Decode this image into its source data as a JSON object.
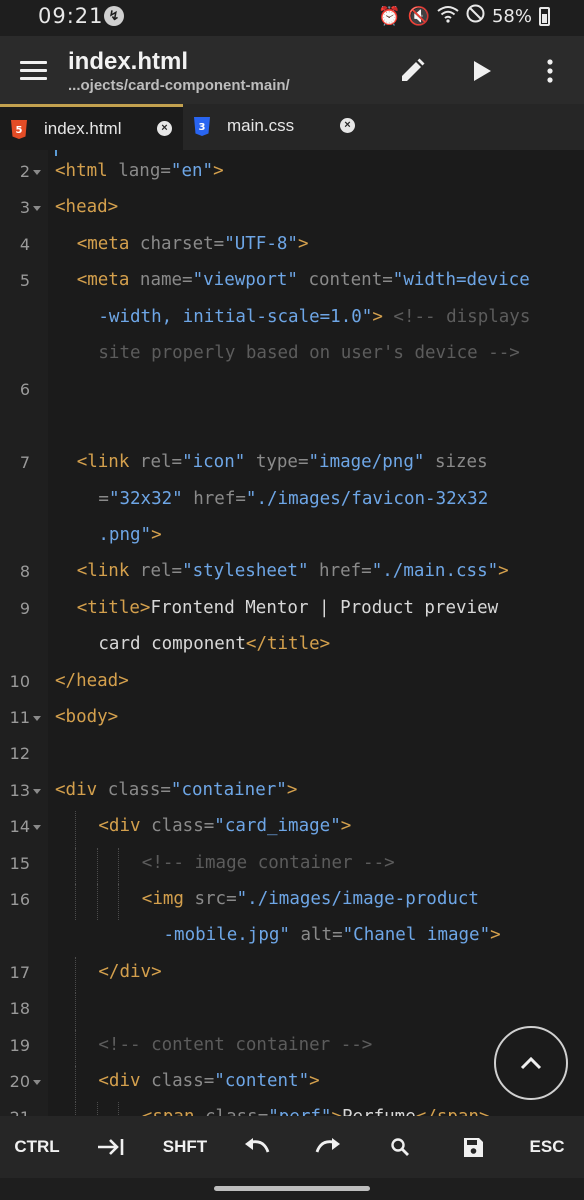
{
  "status_bar": {
    "time": "09:21",
    "battery": "58%"
  },
  "app_bar": {
    "title": "index.html",
    "subtitle": "...ojects/card-component-main/"
  },
  "tabs": [
    {
      "label": "index.html",
      "icon": "html5-icon",
      "active": true
    },
    {
      "label": "main.css",
      "icon": "css3-icon",
      "active": false
    }
  ],
  "lines": [
    {
      "num": "2",
      "fold": true,
      "indent": 0,
      "tokens": [
        [
          "tag",
          "<html "
        ],
        [
          "attr",
          "lang="
        ],
        [
          "str",
          "\"en\""
        ],
        [
          "tag",
          ">"
        ]
      ]
    },
    {
      "num": "3",
      "fold": true,
      "indent": 0,
      "tokens": [
        [
          "tag",
          "<head>"
        ]
      ]
    },
    {
      "num": "4",
      "fold": false,
      "indent": 1,
      "tokens": [
        [
          "tag",
          "<meta "
        ],
        [
          "attr",
          "charset="
        ],
        [
          "str",
          "\"UTF-8\""
        ],
        [
          "tag",
          ">"
        ]
      ]
    },
    {
      "num": "5",
      "fold": false,
      "indent": 1,
      "tokens": [
        [
          "tag",
          "<meta "
        ],
        [
          "attr",
          "name="
        ],
        [
          "str",
          "\"viewport\""
        ],
        [
          "attr",
          " content="
        ],
        [
          "str",
          "\"width=device"
        ]
      ]
    },
    {
      "num": "",
      "fold": false,
      "indent": 2,
      "tokens": [
        [
          "str",
          "-width, initial-scale=1.0\""
        ],
        [
          "tag",
          ">"
        ],
        [
          "cmt",
          " <!-- displays"
        ]
      ]
    },
    {
      "num": "",
      "fold": false,
      "indent": 2,
      "tokens": [
        [
          "cmt",
          "site properly based on user's device -->"
        ]
      ]
    },
    {
      "num": "6",
      "fold": false,
      "indent": 0,
      "tokens": []
    },
    {
      "num": "",
      "fold": false,
      "indent": 0,
      "tokens": []
    },
    {
      "num": "7",
      "fold": false,
      "indent": 1,
      "tokens": [
        [
          "tag",
          "<link "
        ],
        [
          "attr",
          "rel="
        ],
        [
          "str",
          "\"icon\""
        ],
        [
          "attr",
          " type="
        ],
        [
          "str",
          "\"image/png\""
        ],
        [
          "attr",
          " sizes"
        ]
      ]
    },
    {
      "num": "",
      "fold": false,
      "indent": 2,
      "tokens": [
        [
          "attr",
          "="
        ],
        [
          "str",
          "\"32x32\""
        ],
        [
          "attr",
          " href="
        ],
        [
          "str",
          "\"./images/favicon-32x32"
        ]
      ]
    },
    {
      "num": "",
      "fold": false,
      "indent": 2,
      "tokens": [
        [
          "str",
          ".png\""
        ],
        [
          "tag",
          ">"
        ]
      ]
    },
    {
      "num": "8",
      "fold": false,
      "indent": 1,
      "tokens": [
        [
          "tag",
          "<link "
        ],
        [
          "attr",
          "rel="
        ],
        [
          "str",
          "\"stylesheet\""
        ],
        [
          "attr",
          " href="
        ],
        [
          "str",
          "\"./main.css\""
        ],
        [
          "tag",
          ">"
        ]
      ]
    },
    {
      "num": "9",
      "fold": false,
      "indent": 1,
      "tokens": [
        [
          "tag",
          "<title>"
        ],
        [
          "txt",
          "Frontend Mentor | Product preview"
        ]
      ]
    },
    {
      "num": "",
      "fold": false,
      "indent": 2,
      "tokens": [
        [
          "txt",
          "card component"
        ],
        [
          "tag",
          "</title>"
        ]
      ]
    },
    {
      "num": "10",
      "fold": false,
      "indent": 0,
      "tokens": [
        [
          "tag",
          "</head>"
        ]
      ]
    },
    {
      "num": "11",
      "fold": true,
      "indent": 0,
      "tokens": [
        [
          "tag",
          "<body>"
        ]
      ]
    },
    {
      "num": "12",
      "fold": false,
      "indent": 0,
      "tokens": []
    },
    {
      "num": "13",
      "fold": true,
      "indent": 0,
      "tokens": [
        [
          "tag",
          "<div "
        ],
        [
          "attr",
          "class="
        ],
        [
          "str",
          "\"container\""
        ],
        [
          "tag",
          ">"
        ]
      ]
    },
    {
      "num": "14",
      "fold": true,
      "indent": 2,
      "guides": 1,
      "tokens": [
        [
          "tag",
          "<div "
        ],
        [
          "attr",
          "class="
        ],
        [
          "str",
          "\"card_image\""
        ],
        [
          "tag",
          ">"
        ]
      ]
    },
    {
      "num": "15",
      "fold": false,
      "indent": 4,
      "guides": 3,
      "tokens": [
        [
          "cmt",
          "<!-- image container -->"
        ]
      ]
    },
    {
      "num": "16",
      "fold": false,
      "indent": 4,
      "guides": 3,
      "tokens": [
        [
          "tag",
          "<img "
        ],
        [
          "attr",
          "src="
        ],
        [
          "str",
          "\"./images/image-product"
        ]
      ]
    },
    {
      "num": "",
      "fold": false,
      "indent": 5,
      "tokens": [
        [
          "str",
          "-mobile.jpg\""
        ],
        [
          "attr",
          " alt="
        ],
        [
          "str",
          "\"Chanel image\""
        ],
        [
          "tag",
          ">"
        ]
      ]
    },
    {
      "num": "17",
      "fold": false,
      "indent": 2,
      "guides": 1,
      "tokens": [
        [
          "tag",
          "</div>"
        ]
      ]
    },
    {
      "num": "18",
      "fold": false,
      "indent": 0,
      "guides": 1,
      "tokens": []
    },
    {
      "num": "19",
      "fold": false,
      "indent": 2,
      "guides": 1,
      "tokens": [
        [
          "cmt",
          "<!-- content container -->"
        ]
      ]
    },
    {
      "num": "20",
      "fold": true,
      "indent": 2,
      "guides": 1,
      "tokens": [
        [
          "tag",
          "<div "
        ],
        [
          "attr",
          "class="
        ],
        [
          "str",
          "\"content\""
        ],
        [
          "tag",
          ">"
        ]
      ]
    },
    {
      "num": "21",
      "fold": false,
      "indent": 4,
      "guides": 3,
      "tokens": [
        [
          "tag",
          "<span "
        ],
        [
          "attr",
          "class="
        ],
        [
          "str",
          "\"perf\""
        ],
        [
          "tag",
          ">"
        ],
        [
          "txt",
          "Perfume"
        ],
        [
          "tag",
          "</span>"
        ]
      ]
    }
  ],
  "bottom_toolbar": [
    {
      "id": "ctrl",
      "label": "CTRL",
      "icon": ""
    },
    {
      "id": "tab",
      "label": "",
      "icon": "tab-arrow-icon"
    },
    {
      "id": "shift",
      "label": "SHFT",
      "icon": ""
    },
    {
      "id": "undo",
      "label": "",
      "icon": "undo-icon"
    },
    {
      "id": "redo",
      "label": "",
      "icon": "redo-icon"
    },
    {
      "id": "search",
      "label": "",
      "icon": "search-icon"
    },
    {
      "id": "save",
      "label": "",
      "icon": "save-icon"
    },
    {
      "id": "esc",
      "label": "ESC",
      "icon": ""
    }
  ],
  "colors": {
    "tag": "#d4a04d",
    "attr": "#8a8a8a",
    "string": "#6ea6e6",
    "comment": "#5c5c5c",
    "accent": "#c3a14f"
  }
}
